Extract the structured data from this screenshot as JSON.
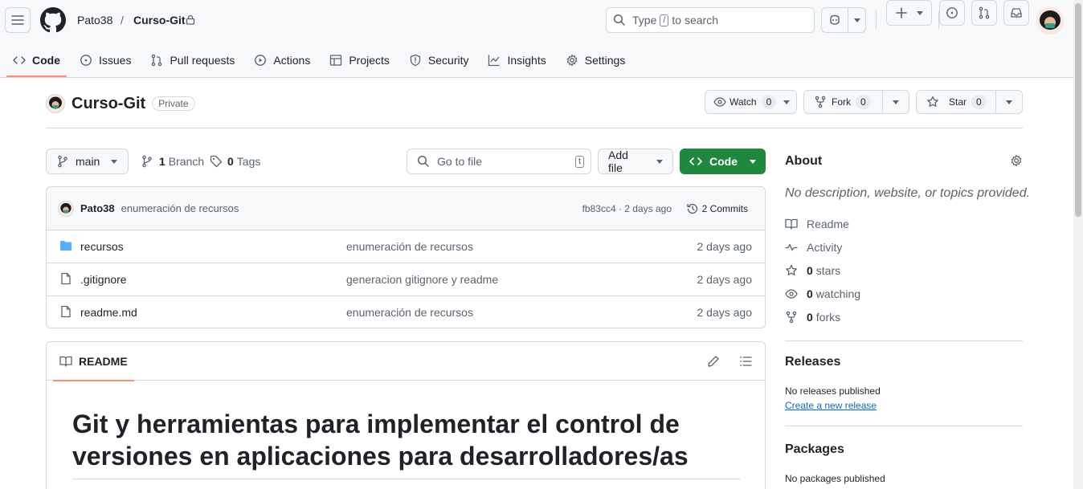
{
  "header": {
    "owner": "Pato38",
    "separator": "/",
    "repo": "Curso-Git",
    "search_prefix": "Type",
    "search_key": "/",
    "search_suffix": "to search",
    "plus": "+"
  },
  "tabs": [
    {
      "label": "Code",
      "icon": "code-icon"
    },
    {
      "label": "Issues",
      "icon": "issue-icon"
    },
    {
      "label": "Pull requests",
      "icon": "pull-request-icon"
    },
    {
      "label": "Actions",
      "icon": "play-icon"
    },
    {
      "label": "Projects",
      "icon": "table-icon"
    },
    {
      "label": "Security",
      "icon": "shield-icon"
    },
    {
      "label": "Insights",
      "icon": "graph-icon"
    },
    {
      "label": "Settings",
      "icon": "gear-icon"
    }
  ],
  "repo": {
    "name": "Curso-Git",
    "visibility": "Private",
    "watch_label": "Watch",
    "watch_count": "0",
    "fork_label": "Fork",
    "fork_count": "0",
    "star_label": "Star",
    "star_count": "0"
  },
  "toolbar": {
    "branch": "main",
    "branch_count": "1",
    "branch_label": "Branch",
    "tag_count": "0",
    "tag_label": "Tags",
    "goto_placeholder": "Go to file",
    "goto_key": "t",
    "add_file": "Add file",
    "code": "Code"
  },
  "commit": {
    "author": "Pato38",
    "message": "enumeración de recursos",
    "hash_info": "fb83cc4 · 2 days ago",
    "commits": "2 Commits"
  },
  "files": [
    {
      "name": "recursos",
      "type": "folder",
      "message": "enumeración de recursos",
      "date": "2 days ago"
    },
    {
      "name": ".gitignore",
      "type": "file",
      "message": "generacion gitignore y readme",
      "date": "2 days ago"
    },
    {
      "name": "readme.md",
      "type": "file",
      "message": "enumeración de recursos",
      "date": "2 days ago"
    }
  ],
  "readme": {
    "tab": "README",
    "heading": "Git y herramientas para implementar el control de versiones en aplicaciones para desarrolladores/as"
  },
  "about": {
    "title": "About",
    "description": "No description, website, or topics provided.",
    "readme": "Readme",
    "activity": "Activity",
    "stars_count": "0",
    "stars_label": "stars",
    "watching_count": "0",
    "watching_label": "watching",
    "forks_count": "0",
    "forks_label": "forks"
  },
  "releases": {
    "title": "Releases",
    "none": "No releases published",
    "create_link": "Create a new release"
  },
  "packages": {
    "title": "Packages",
    "none": "No packages published"
  },
  "colors": {
    "accent_tab": "#fd8c73",
    "primary_button": "#1f883d",
    "folder": "#54aeff",
    "link": "#0969da"
  }
}
